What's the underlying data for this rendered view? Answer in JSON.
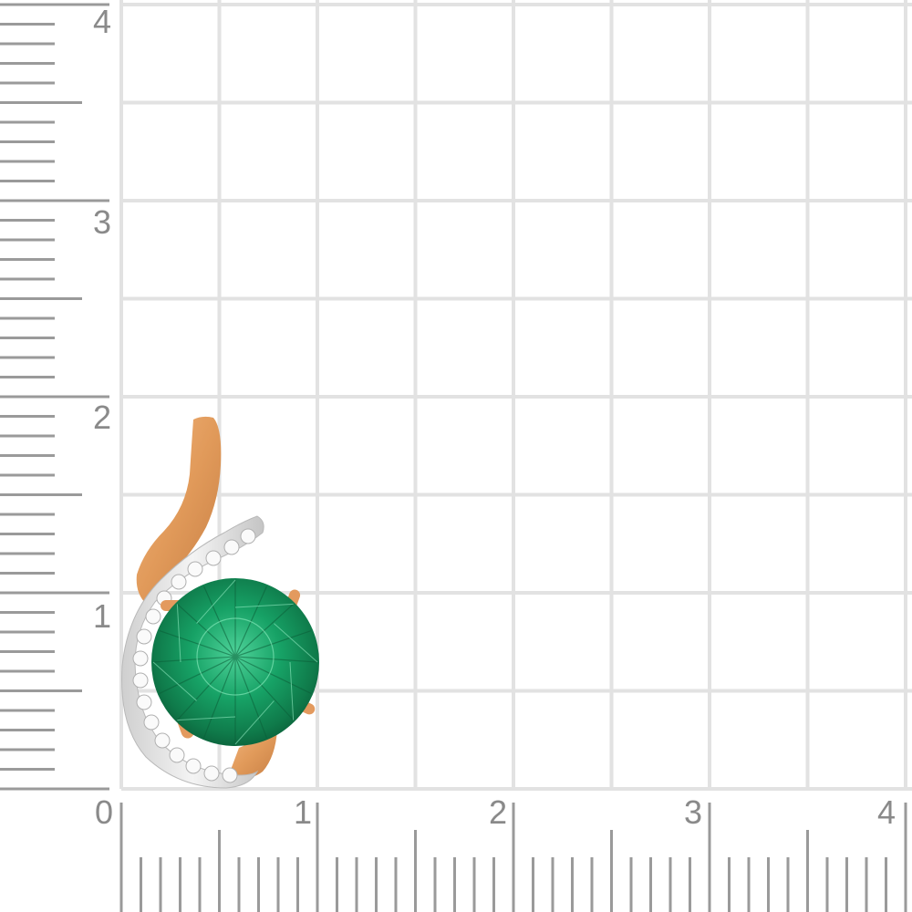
{
  "ruler": {
    "vertical_labels": [
      "4",
      "3",
      "2",
      "1"
    ],
    "horizontal_labels": [
      "0",
      "1",
      "2",
      "3",
      "4"
    ]
  },
  "colors": {
    "background": "#ffffff",
    "grid_line": "#e2e2e2",
    "ruler_tick": "#9a9a9a",
    "label": "#8a8a8a",
    "gold": "#e3a064",
    "white_gold": "#dcdcdc",
    "emerald": "#1c9a63"
  }
}
